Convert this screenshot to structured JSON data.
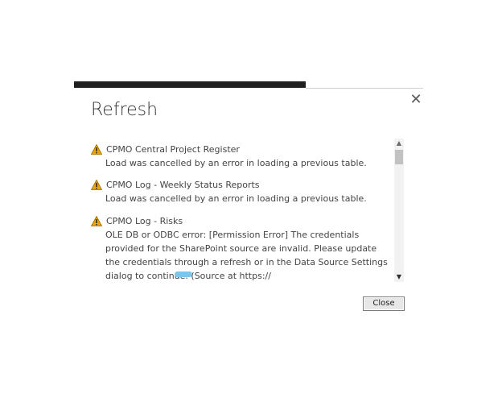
{
  "dialog": {
    "title": "Refresh",
    "close_glyph": "✕",
    "close_button_label": "Close"
  },
  "messages": [
    {
      "icon": "warning-icon",
      "title": "CPMO Central Project Register",
      "body": "Load was cancelled by an error in loading a previous table."
    },
    {
      "icon": "warning-icon",
      "title": "CPMO Log - Weekly Status Reports",
      "body": "Load was cancelled by an error in loading a previous table."
    },
    {
      "icon": "warning-icon",
      "title": "CPMO Log - Risks",
      "body": "OLE DB or ODBC error: [Permission Error] The credentials provided for the SharePoint source are invalid. Please update the credentials through a refresh or in the Data Source Settings dialog to continue. (Source at https://███████████████/CPMO.)."
    }
  ],
  "scrollbar": {
    "up_glyph": "▲",
    "down_glyph": "▼"
  },
  "colors": {
    "warning": "#e5a514",
    "mask": "#7dc6ea"
  }
}
